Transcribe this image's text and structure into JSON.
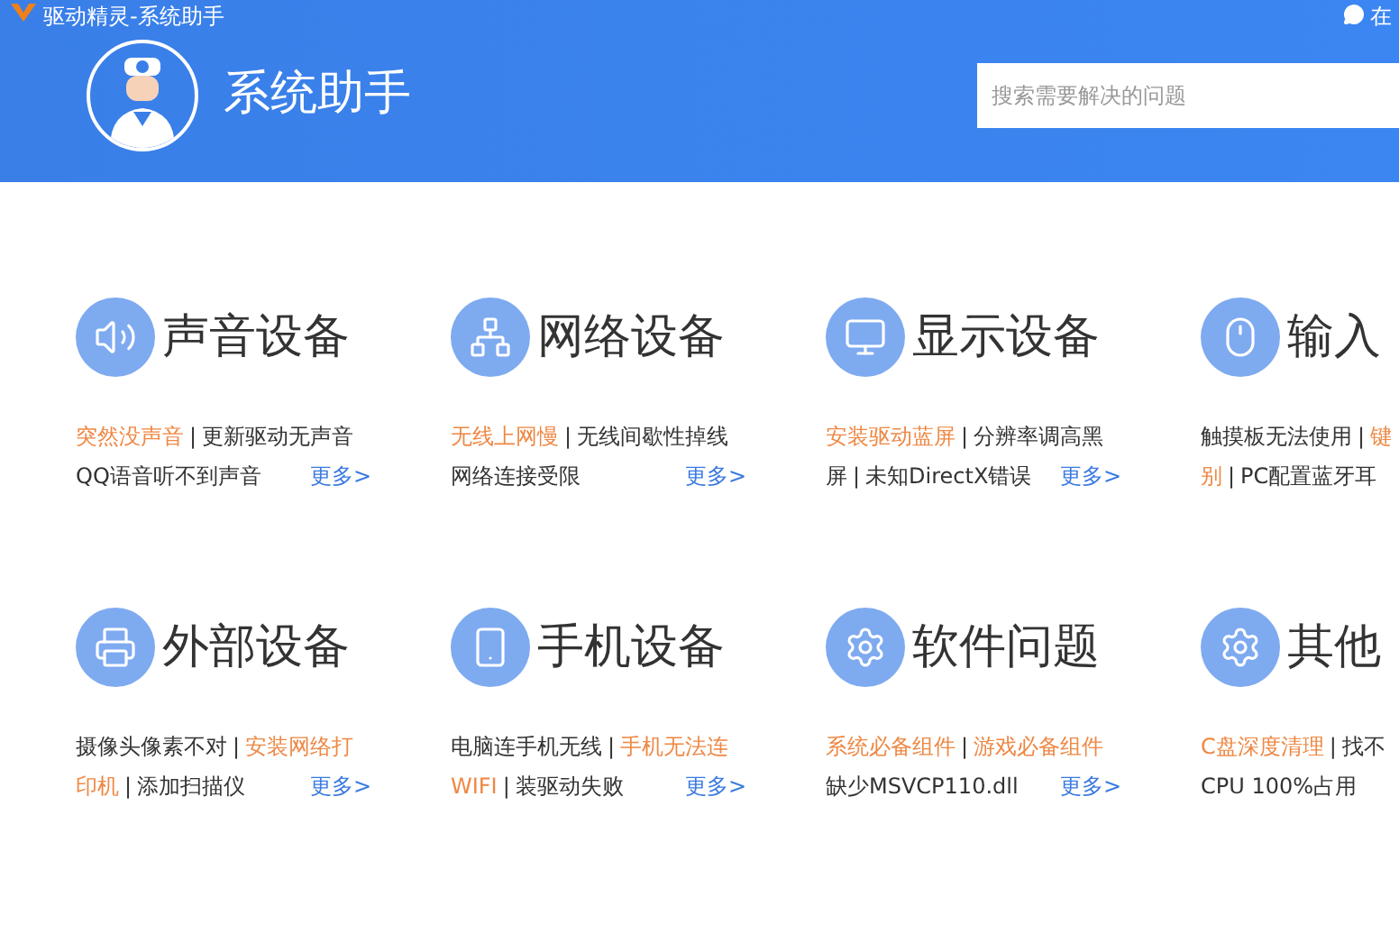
{
  "window": {
    "title": "驱动精灵-系统助手",
    "top_right_link": "在"
  },
  "header": {
    "title": "系统助手",
    "search": {
      "placeholder": "搜索需要解决的问题"
    }
  },
  "categories": [
    {
      "kind": "speaker",
      "title": "声音设备",
      "lines": [
        [
          {
            "text": "突然没声音",
            "hot": true
          },
          {
            "text": "|",
            "hot": false
          },
          {
            "text": "更新驱动无声音",
            "hot": false
          }
        ],
        [
          {
            "text": "QQ语音听不到声音",
            "hot": false
          }
        ]
      ],
      "more": "更多>"
    },
    {
      "kind": "network",
      "title": "网络设备",
      "lines": [
        [
          {
            "text": "无线上网慢",
            "hot": true
          },
          {
            "text": "|",
            "hot": false
          },
          {
            "text": "无线间歇性掉线",
            "hot": false
          }
        ],
        [
          {
            "text": "网络连接受限",
            "hot": false
          }
        ]
      ],
      "more": "更多>"
    },
    {
      "kind": "monitor",
      "title": "显示设备",
      "lines": [
        [
          {
            "text": "安装驱动蓝屏",
            "hot": true
          },
          {
            "text": "|",
            "hot": false
          },
          {
            "text": "分辨率调高黑",
            "hot": false
          }
        ],
        [
          {
            "text": "屏",
            "hot": false
          },
          {
            "text": "|",
            "hot": false
          },
          {
            "text": "未知DirectX错误",
            "hot": false
          }
        ]
      ],
      "more": "更多>"
    },
    {
      "kind": "mouse",
      "title": "输入",
      "lines": [
        [
          {
            "text": "触摸板无法使用",
            "hot": false
          },
          {
            "text": "|",
            "hot": false
          },
          {
            "text": "键",
            "hot": true
          }
        ],
        [
          {
            "text": "别",
            "hot": true
          },
          {
            "text": "|",
            "hot": false
          },
          {
            "text": "PC配置蓝牙耳",
            "hot": false
          }
        ]
      ]
    },
    {
      "kind": "printer",
      "title": "外部设备",
      "lines": [
        [
          {
            "text": "摄像头像素不对",
            "hot": false
          },
          {
            "text": "|",
            "hot": false
          },
          {
            "text": "安装网络打",
            "hot": true
          }
        ],
        [
          {
            "text": "印机",
            "hot": true
          },
          {
            "text": "|",
            "hot": false
          },
          {
            "text": "添加扫描仪",
            "hot": false
          }
        ]
      ],
      "more": "更多>"
    },
    {
      "kind": "phone",
      "title": "手机设备",
      "lines": [
        [
          {
            "text": "电脑连手机无线",
            "hot": false
          },
          {
            "text": "|",
            "hot": false
          },
          {
            "text": "手机无法连",
            "hot": true
          }
        ],
        [
          {
            "text": "WIFI",
            "hot": true
          },
          {
            "text": "|",
            "hot": false
          },
          {
            "text": "装驱动失败",
            "hot": false
          }
        ]
      ],
      "more": "更多>"
    },
    {
      "kind": "gear",
      "title": "软件问题",
      "lines": [
        [
          {
            "text": "系统必备组件",
            "hot": true
          },
          {
            "text": "|",
            "hot": false
          },
          {
            "text": "游戏必备组件",
            "hot": true
          }
        ],
        [
          {
            "text": "缺少MSVCP110.dll",
            "hot": false
          }
        ]
      ],
      "more": "更多>"
    },
    {
      "kind": "gear",
      "title": "其他",
      "lines": [
        [
          {
            "text": "C盘深度清理",
            "hot": true
          },
          {
            "text": "|",
            "hot": false
          },
          {
            "text": "找不",
            "hot": false
          }
        ],
        [
          {
            "text": "CPU 100%占用",
            "hot": false
          }
        ]
      ]
    }
  ]
}
